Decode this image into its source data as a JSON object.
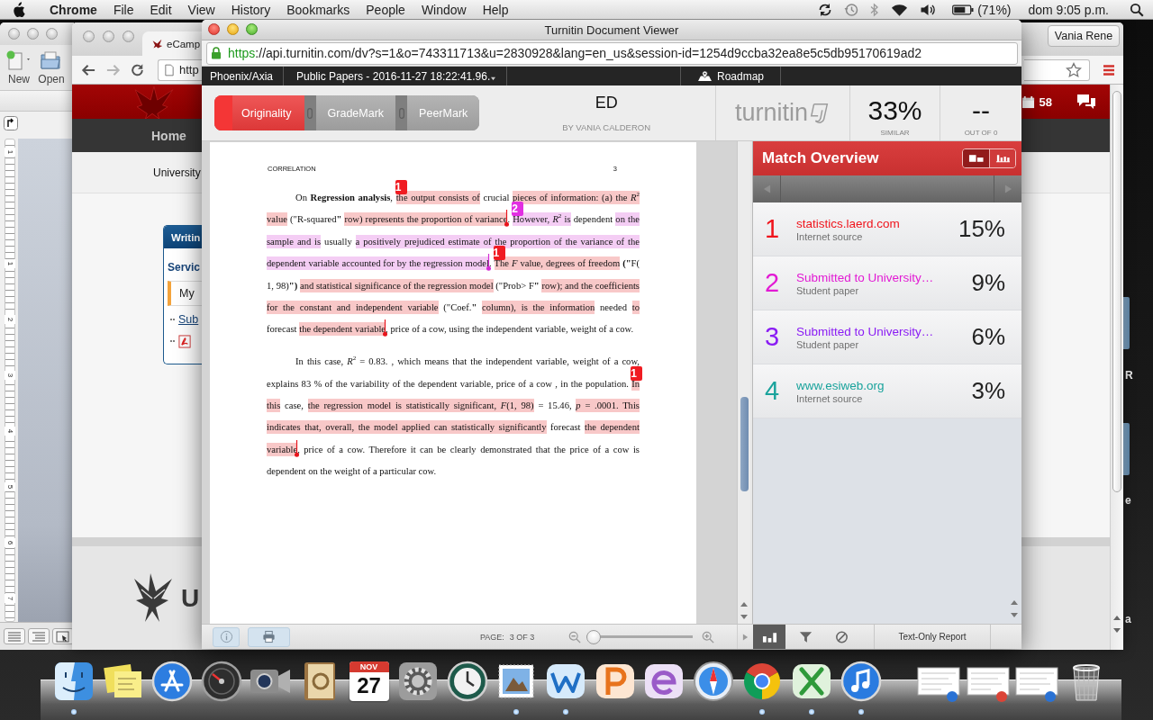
{
  "menu_bar": {
    "app": "Chrome",
    "menus": [
      "File",
      "Edit",
      "View",
      "History",
      "Bookmarks",
      "People",
      "Window",
      "Help"
    ],
    "battery": "(71%)",
    "clock": "dom 9:05 p.m."
  },
  "word_window": {
    "toolbar": [
      "New",
      "Open"
    ],
    "ruler_numbers": [
      "1",
      "1",
      "2",
      "3",
      "4",
      "5",
      "6",
      "7"
    ]
  },
  "browser": {
    "tab": "eCamp",
    "url": "http",
    "profile": "Vania Rene",
    "notifications": "58",
    "nav": "Home",
    "subtitle": "University",
    "card": {
      "title": "Writin",
      "heading": "Servic",
      "items": [
        {
          "kind": "current",
          "label": "My"
        },
        {
          "kind": "link",
          "label": "Sub"
        },
        {
          "kind": "pdf"
        }
      ]
    },
    "footer_logo": "U"
  },
  "desktop_text": [
    "R",
    "e",
    "a"
  ],
  "viewer": {
    "title": "Turnitin Document Viewer",
    "url": {
      "scheme": "https",
      "rest": "://api.turnitin.com/dv?s=1&o=743311713&u=2830928&lang=en_us&session-id=1254d9ccba32ea8e5c5db95170619ad2"
    },
    "class_name": "Phoenix/Axia",
    "assignment": "Public Papers - 2016-11-27 18:22:41.96.",
    "roadmap": "Roadmap",
    "tabs": [
      {
        "label": "Originality",
        "selected": true
      },
      {
        "label": "GradeMark",
        "selected": false
      },
      {
        "label": "PeerMark",
        "selected": false
      }
    ],
    "paper_title": "ED",
    "author": "BY VANIA CALDERON",
    "logo": "turnitin",
    "similarity": "33%",
    "similarity_label": "SIMILAR",
    "grade": "--",
    "grade_label": "OUT OF 0"
  },
  "document": {
    "running_head": "CORRELATION",
    "page_number": "3",
    "paragraphs": [
      {
        "lines": [
          [
            {
              "text": "On **Regression analysis**, "
            },
            {
              "text": "the output consists of",
              "color": "#f8c8c8",
              "badge": {
                "text": "1",
                "color": "#f01c22"
              }
            },
            {
              "text": " crucial "
            },
            {
              "text": "pieces of information: (a) the *R*$^{2}$",
              "color": "#f8c8c8"
            }
          ],
          [
            {
              "text": "value",
              "color": "#f8c8c8"
            },
            {
              "text": " (\"R-squared**\"** "
            },
            {
              "text": "row) represents the proportion of variance",
              "color": "#f8c8c8",
              "end_mark": {
                "color": "#e8141c"
              }
            },
            {
              "text": ". "
            },
            {
              "text": "However, *R*$^{2}$ is",
              "color": "#f4cdf4",
              "badge": {
                "text": "2",
                "color": "#e22ee2"
              }
            },
            {
              "text": " dependent "
            },
            {
              "text": "on the",
              "color": "#f4cdf4"
            }
          ],
          [
            {
              "text": "sample and is",
              "color": "#f4cdf4"
            },
            {
              "text": " usually "
            },
            {
              "text": "a positively prejudiced estimate of the proportion of the variance of the",
              "color": "#f4cdf4"
            }
          ],
          [
            {
              "text": "dependent variable accounted for by the regression model",
              "color": "#f4cdf4",
              "end_mark": {
                "color": "#d42ad4"
              }
            },
            {
              "text": ". "
            },
            {
              "text": "The *F* value, degrees of freedom",
              "color": "#f8c8c8",
              "badge": {
                "text": "1",
                "color": "#f01c22"
              }
            },
            {
              "text": " **(\"**F("
            }
          ],
          [
            {
              "text": "1, 98)**\")** "
            },
            {
              "text": "and statistical significance of the regression model",
              "color": "#f8c8c8"
            },
            {
              "text": " (\"Prob> F**\"** "
            },
            {
              "text": "row); and the coefficients",
              "color": "#f8c8c8"
            }
          ],
          [
            {
              "text": "for the constant and independent variable",
              "color": "#f8c8c8"
            },
            {
              "text": " (\"Coef.**\"** "
            },
            {
              "text": "column), is the information",
              "color": "#f8c8c8"
            },
            {
              "text": " needed "
            },
            {
              "text": "to",
              "color": "#f8c8c8"
            }
          ],
          [
            {
              "text": "forecast "
            },
            {
              "text": "the dependent variable",
              "color": "#f8c8c8",
              "end_mark": {
                "color": "#e8141c"
              }
            },
            {
              "text": ", price of a cow, using the independent variable, weight of a cow."
            }
          ]
        ]
      },
      {
        "lines": [
          [
            {
              "text": "In this case, *R*$^{2}$ = 0.83. , which means that the independent variable, weight of a cow,"
            }
          ],
          [
            {
              "text": "explains 83 % of the variability of the dependent variable, price of a cow , in the population. "
            },
            {
              "text": "In",
              "color": "#f8c8c8",
              "badge": {
                "text": "1",
                "color": "#f01c22"
              }
            }
          ],
          [
            {
              "text": "this",
              "color": "#f8c8c8"
            },
            {
              "text": " case, "
            },
            {
              "text": "the regression model is statistically significant, *F*(1, 98)",
              "color": "#f8c8c8"
            },
            {
              "text": " = 15.46, "
            },
            {
              "text": "*p* = .0001. This",
              "color": "#f8c8c8"
            }
          ],
          [
            {
              "text": "indicates that, overall, the model applied can statistically significantly",
              "color": "#f8c8c8"
            },
            {
              "text": " forecast "
            },
            {
              "text": "the dependent",
              "color": "#f8c8c8"
            }
          ],
          [
            {
              "text": "variable",
              "color": "#f8c8c8",
              "end_mark": {
                "color": "#e8141c"
              }
            },
            {
              "text": ", price of a cow. Therefore it can be clearly demonstrated that the price of a cow is"
            }
          ],
          [
            {
              "text": "dependent on the weight of a particular cow."
            }
          ]
        ]
      }
    ]
  },
  "match_overview": {
    "title": "Match Overview",
    "view_toggle": [
      {
        "kind": "list",
        "selected": true
      },
      {
        "kind": "bars",
        "selected": false
      }
    ],
    "matches": [
      {
        "number": "1",
        "source": "statistics.laerd.com",
        "type": "Internet source",
        "percent": "15%",
        "color": "#f0141c"
      },
      {
        "number": "2",
        "source": "Submitted to University…",
        "type": "Student paper",
        "percent": "9%",
        "color": "#e21ad4"
      },
      {
        "number": "3",
        "source": "Submitted to University…",
        "type": "Student paper",
        "percent": "6%",
        "color": "#8a1cf4"
      },
      {
        "number": "4",
        "source": "www.esiweb.org",
        "type": "Internet source",
        "percent": "3%",
        "color": "#1aa39c"
      }
    ]
  },
  "viewer_footer": {
    "page_label": "PAGE:",
    "page": "3 OF 3",
    "zoom": {
      "level": 0
    },
    "panel_tools": [
      {
        "kind": "overview",
        "selected": true
      },
      {
        "kind": "filter",
        "selected": false
      },
      {
        "kind": "exclude",
        "selected": false
      }
    ],
    "text_only_report": "Text-Only Report"
  },
  "dock": {
    "items": [
      {
        "kind": "finder",
        "running": true
      },
      {
        "kind": "stickies",
        "running": false
      },
      {
        "kind": "app_store",
        "running": false
      },
      {
        "kind": "dashboard",
        "running": false
      },
      {
        "kind": "facetime",
        "running": false
      },
      {
        "kind": "contacts",
        "running": false
      },
      {
        "kind": "calendar",
        "month": "NOV",
        "day": "27",
        "running": false
      },
      {
        "kind": "system_preferences",
        "running": false
      },
      {
        "kind": "time_machine",
        "running": false
      },
      {
        "kind": "mail",
        "running": true
      },
      {
        "kind": "word",
        "running": true
      },
      {
        "kind": "powerpoint",
        "running": false
      },
      {
        "kind": "entourage",
        "running": false
      },
      {
        "kind": "safari",
        "running": false
      },
      {
        "kind": "chrome",
        "running": true
      },
      {
        "kind": "excel",
        "running": true
      },
      {
        "kind": "itunes",
        "running": true
      },
      {
        "kind": "window",
        "color": "#2a72d4"
      },
      {
        "kind": "window",
        "color": "#db4437"
      },
      {
        "kind": "window",
        "color": "#2a72d4"
      },
      {
        "kind": "trash"
      }
    ]
  }
}
